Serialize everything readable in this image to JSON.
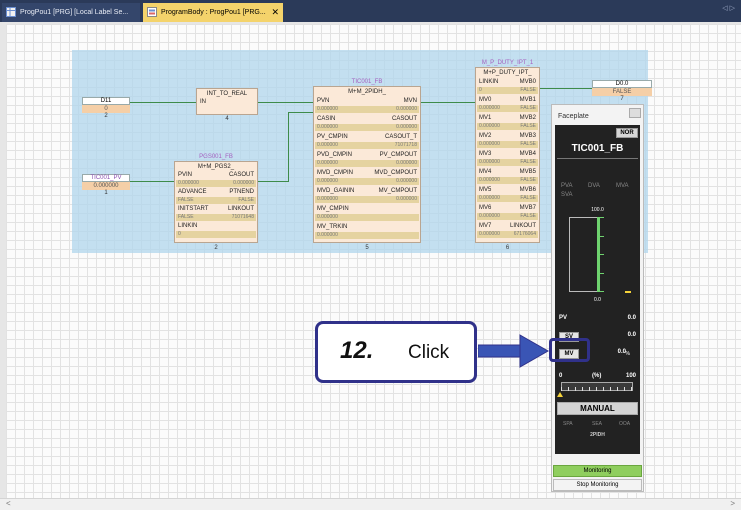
{
  "tabs": [
    {
      "label": "ProgPou1 [PRG] [Local Label Se..."
    },
    {
      "label": "ProgramBody : ProgPou1 [PRG..."
    }
  ],
  "tab_scroll": "◁ ▷",
  "variables": {
    "d11": {
      "name": "D11",
      "value": "0",
      "num": "2"
    },
    "tic001_pv": {
      "name": "TIC001_PV",
      "value": "0.000000",
      "num": "1"
    },
    "d0_0": {
      "name": "D0.0",
      "value": "FALSE",
      "num": "7"
    }
  },
  "fb_int_to_real": {
    "title": "INT_TO_REAL",
    "pin_in": "IN",
    "num": "4"
  },
  "fb_pgs001": {
    "instance": "PGS001_FB",
    "type": "M+M_PGS2_",
    "num": "2",
    "rows": [
      {
        "l": "PVIN",
        "r": "CASOUT",
        "va": "0.000000",
        "vb": "0.000000"
      },
      {
        "l": "ADVANCE",
        "r": "PTNEND",
        "va": "FALSE",
        "vb": "FALSE"
      },
      {
        "l": "INITSTART",
        "r": "LINKOUT",
        "va": "FALSE",
        "vb": "71071648"
      },
      {
        "l": "LINKIN",
        "r": "",
        "va": "0",
        "vb": ""
      }
    ]
  },
  "fb_tic001": {
    "instance": "TIC001_FB",
    "type": "M+M_2PIDH_",
    "num": "5",
    "rows": [
      {
        "l": "PVN",
        "r": "MVN",
        "va": "0.000000",
        "vb": "0.000000"
      },
      {
        "l": "CASIN",
        "r": "CASOUT",
        "va": "0.000000",
        "vb": "0.000000"
      },
      {
        "l": "PV_CMPIN",
        "r": "CASOUT_T",
        "va": "0.000000",
        "vb": "71071718"
      },
      {
        "l": "PVD_CMPIN",
        "r": "PV_CMPOUT",
        "va": "0.000000",
        "vb": "0.000000"
      },
      {
        "l": "MVD_CMPIN",
        "r": "MVD_CMPOUT",
        "va": "0.000000",
        "vb": "0.000000"
      },
      {
        "l": "MVD_GAININ",
        "r": "MV_CMPOUT",
        "va": "0.000000",
        "vb": "0.000000"
      },
      {
        "l": "MV_CMPIN",
        "r": "",
        "va": "0.000000",
        "vb": ""
      },
      {
        "l": "MV_TRKIN",
        "r": "",
        "va": "0.000000",
        "vb": ""
      }
    ]
  },
  "fb_mduty": {
    "instance": "M_P_DUTY_IPT_1",
    "type": "M+P_DUTY_IPT_",
    "num": "6",
    "rows": [
      {
        "l": "LINKIN",
        "r": "MVB0",
        "va": "0",
        "vb": "FALSE"
      },
      {
        "l": "MV0",
        "r": "MVB1",
        "va": "0.000000",
        "vb": "FALSE"
      },
      {
        "l": "MV1",
        "r": "MVB2",
        "va": "0.000000",
        "vb": "FALSE"
      },
      {
        "l": "MV2",
        "r": "MVB3",
        "va": "0.000000",
        "vb": "FALSE"
      },
      {
        "l": "MV3",
        "r": "MVB4",
        "va": "0.000000",
        "vb": "FALSE"
      },
      {
        "l": "MV4",
        "r": "MVB5",
        "va": "0.000000",
        "vb": "FALSE"
      },
      {
        "l": "MV5",
        "r": "MVB6",
        "va": "0.000000",
        "vb": "FALSE"
      },
      {
        "l": "MV6",
        "r": "MVB7",
        "va": "0.000000",
        "vb": "FALSE"
      },
      {
        "l": "MV7",
        "r": "LINKOUT",
        "va": "0.000000",
        "vb": "67176064"
      }
    ]
  },
  "faceplate": {
    "title": "Faceplate",
    "status": "NOR",
    "tag": "TIC001_FB",
    "labels_top": [
      "PVA",
      "DVA",
      "MVA"
    ],
    "label_sva": "SVA",
    "bar_max": "100.0",
    "bar_min": "0.0",
    "pv_label": "PV",
    "pv_value": "0.0",
    "sv_button": "SV",
    "sv_value": "0.0",
    "mv_button": "MV",
    "mv_value": "0.0",
    "mv_unit": "%",
    "scale_min": "0",
    "scale_unit": "(%)",
    "scale_max": "100",
    "mode_button": "MANUAL",
    "modes": [
      "SPA",
      "SEA",
      "OOA"
    ],
    "fb_type": "2PIDH",
    "monitoring_button": "Monitoring",
    "stop_button": "Stop Monitoring",
    "mv_position_percent": 0
  },
  "callout": {
    "step": "12.",
    "text": "Click"
  },
  "scrollbar": {
    "left": "<",
    "right": ">"
  }
}
